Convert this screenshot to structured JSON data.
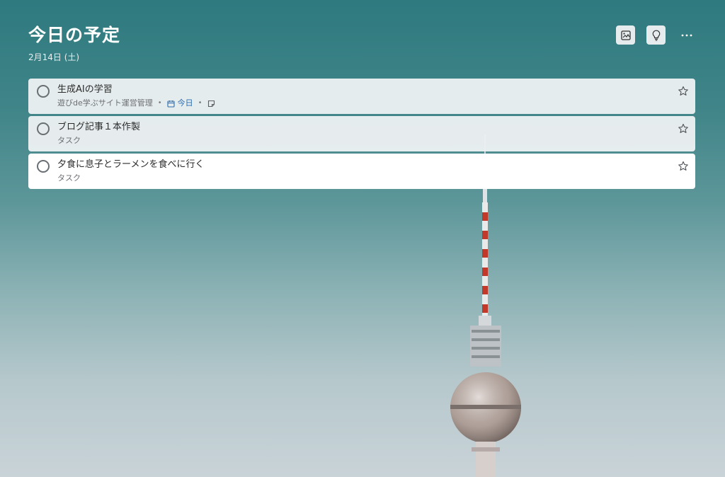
{
  "header": {
    "title": "今日の予定",
    "date": "2月14日 (土)"
  },
  "tasks": [
    {
      "title": "生成AIの学習",
      "list": "遊びde学ぶサイト運営管理",
      "due": "今日",
      "has_note": true
    },
    {
      "title": "ブログ記事１本作製",
      "list": "タスク"
    },
    {
      "title": "夕食に息子とラーメンを食べに行く",
      "list": "タスク"
    }
  ],
  "colors": {
    "accent": "#2b6cb0",
    "title": "#ffffff"
  },
  "icons": {
    "background": "image-icon",
    "suggestions": "lightbulb-icon",
    "more": "more-icon",
    "star": "star-icon",
    "calendar": "calendar-icon",
    "note": "note-icon"
  }
}
